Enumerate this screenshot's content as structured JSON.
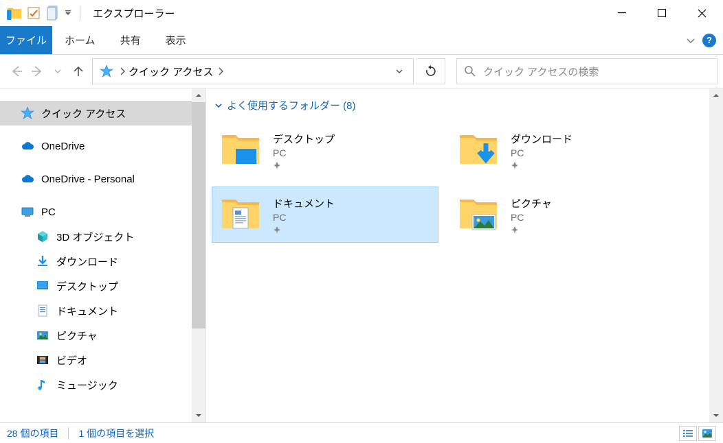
{
  "window": {
    "title": "エクスプローラー"
  },
  "ribbon": {
    "file": "ファイル",
    "tabs": [
      "ホーム",
      "共有",
      "表示"
    ]
  },
  "breadcrumbs": {
    "location": "クイック アクセス"
  },
  "search": {
    "placeholder": "クイック アクセスの検索"
  },
  "navpane": {
    "items": [
      {
        "label": "クイック アクセス",
        "icon": "star",
        "selected": true,
        "child": false
      },
      {
        "label": "OneDrive",
        "icon": "cloud",
        "child": false,
        "spacerBefore": true
      },
      {
        "label": "OneDrive - Personal",
        "icon": "cloud",
        "child": false,
        "spacerBefore": true
      },
      {
        "label": "PC",
        "icon": "pc",
        "child": false,
        "spacerBefore": true
      },
      {
        "label": "3D オブジェクト",
        "icon": "3d",
        "child": true
      },
      {
        "label": "ダウンロード",
        "icon": "download",
        "child": true
      },
      {
        "label": "デスクトップ",
        "icon": "desktop",
        "child": true
      },
      {
        "label": "ドキュメント",
        "icon": "doc",
        "child": true
      },
      {
        "label": "ピクチャ",
        "icon": "pictures",
        "child": true
      },
      {
        "label": "ビデオ",
        "icon": "video",
        "child": true
      },
      {
        "label": "ミュージック",
        "icon": "music",
        "child": true
      }
    ]
  },
  "section": {
    "header": "よく使用するフォルダー (8)"
  },
  "folders": [
    {
      "name": "デスクトップ",
      "sub": "PC",
      "icon": "desktop",
      "selected": false
    },
    {
      "name": "ダウンロード",
      "sub": "PC",
      "icon": "download",
      "selected": false
    },
    {
      "name": "ドキュメント",
      "sub": "PC",
      "icon": "doc",
      "selected": true
    },
    {
      "name": "ピクチャ",
      "sub": "PC",
      "icon": "pictures",
      "selected": false
    }
  ],
  "status": {
    "items": "28 個の項目",
    "selected": "1 個の項目を選択"
  }
}
